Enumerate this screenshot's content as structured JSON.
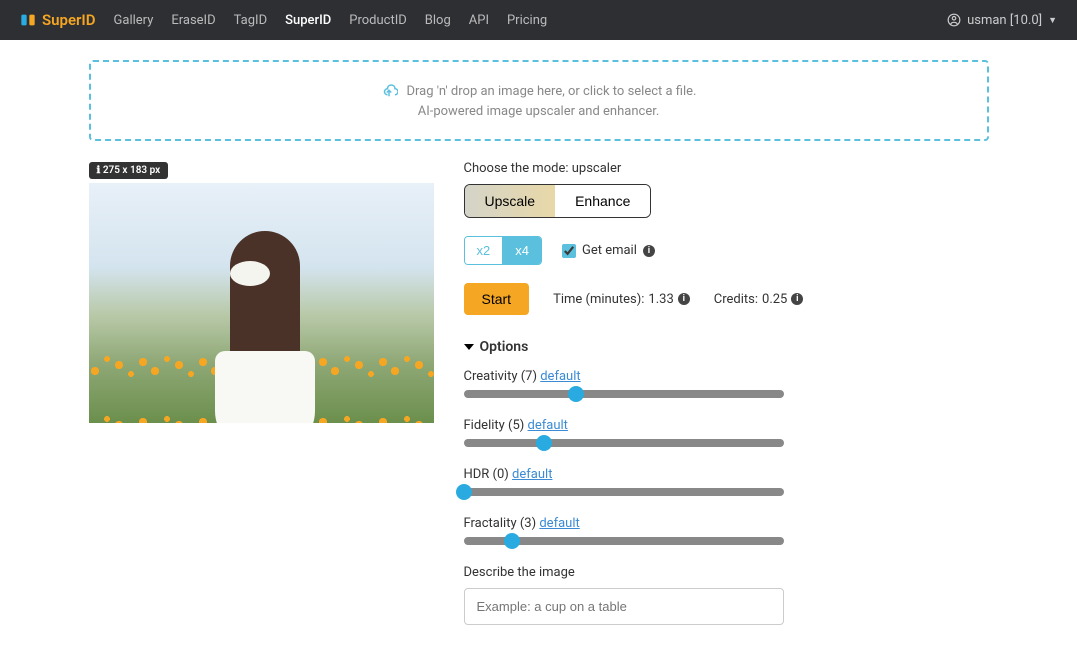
{
  "nav": {
    "brand": "SuperID",
    "links": [
      "Gallery",
      "EraseID",
      "TagID",
      "SuperID",
      "ProductID",
      "Blog",
      "API",
      "Pricing"
    ],
    "active_index": 3,
    "user": "usman [10.0]"
  },
  "dropzone": {
    "line1": "Drag 'n' drop an image here, or click to select a file.",
    "line2": "AI-powered image upscaler and enhancer."
  },
  "image": {
    "badge_prefix": "ℹ",
    "badge": "275 x 183 px"
  },
  "mode": {
    "label_prefix": "Choose the mode:",
    "current": "upscaler",
    "tabs": [
      "Upscale",
      "Enhance"
    ],
    "active_tab": 0
  },
  "scale": {
    "options": [
      "x2",
      "x4"
    ],
    "active": 1
  },
  "email": {
    "label": "Get email",
    "checked": true
  },
  "start": {
    "button": "Start",
    "time_label": "Time (minutes):",
    "time_value": "1.33",
    "credits_label": "Credits:",
    "credits_value": "0.25"
  },
  "options": {
    "header": "Options",
    "sliders": [
      {
        "name": "Creativity",
        "value": 7,
        "max": 20,
        "default_label": "default"
      },
      {
        "name": "Fidelity",
        "value": 5,
        "max": 20,
        "default_label": "default"
      },
      {
        "name": "HDR",
        "value": 0,
        "max": 20,
        "default_label": "default"
      },
      {
        "name": "Fractality",
        "value": 3,
        "max": 20,
        "default_label": "default"
      }
    ]
  },
  "describe": {
    "label": "Describe the image",
    "placeholder": "Example: a cup on a table"
  }
}
